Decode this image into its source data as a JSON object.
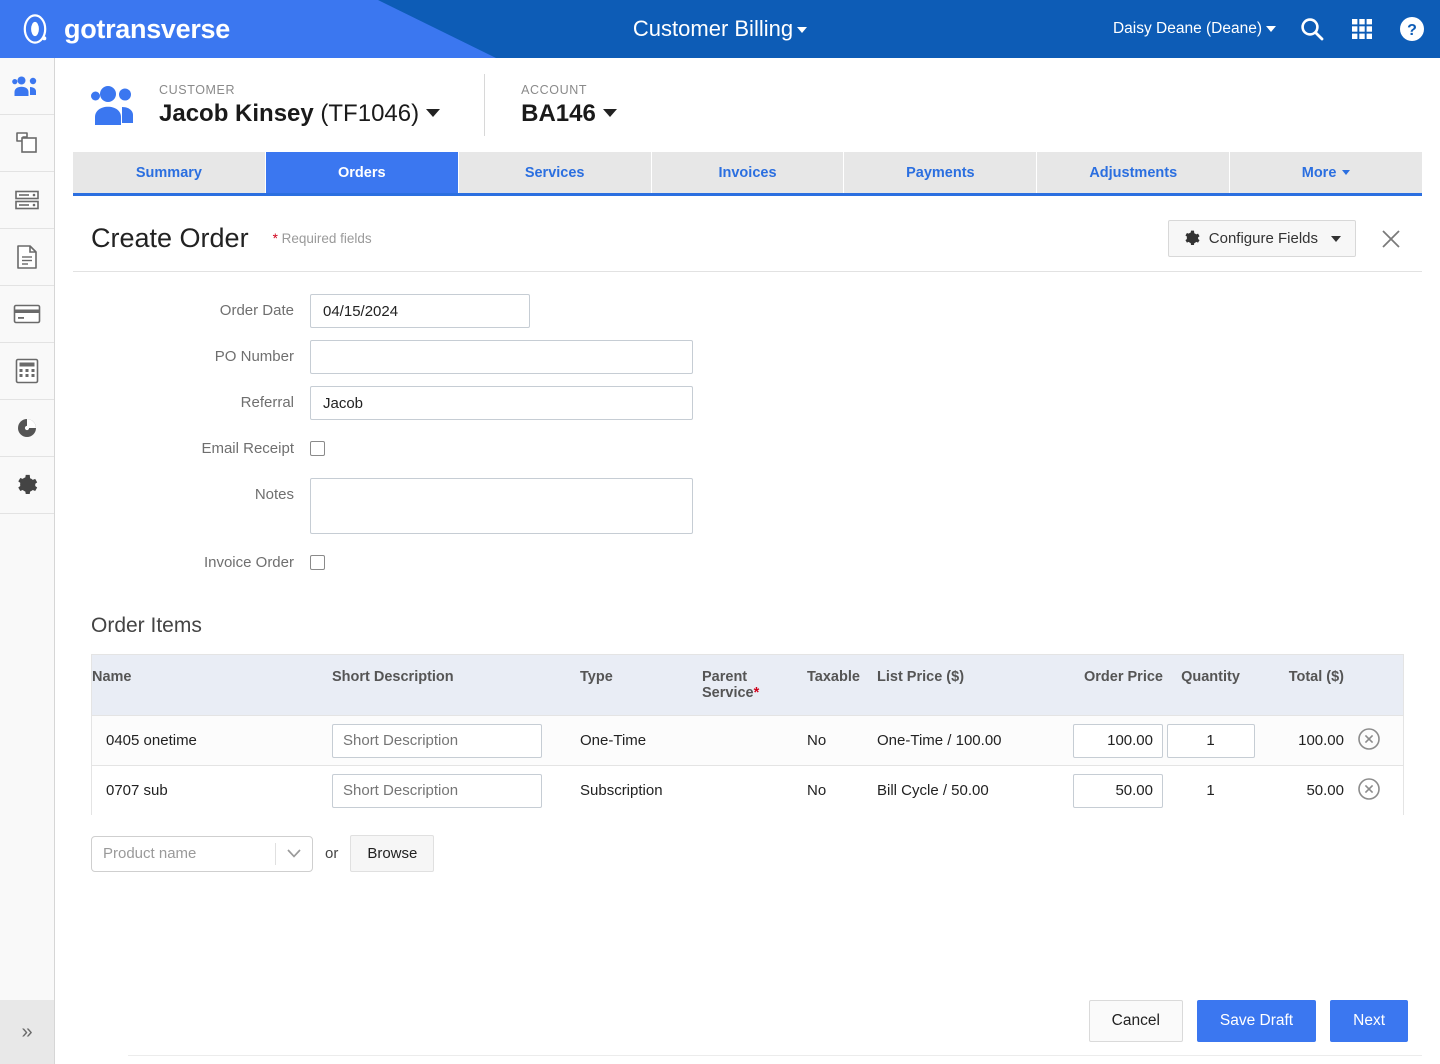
{
  "header": {
    "brand": "gotransverse",
    "brand_logo_icon": "gotransverse-logo-icon",
    "app_title": "Customer Billing",
    "user": "Daisy Deane (Deane)",
    "icons": [
      "search-icon",
      "apps-grid-icon",
      "help-icon"
    ],
    "accent_blue": "#0d5cb6",
    "accent_blue_light": "#3b77f0"
  },
  "sidebar": {
    "items": [
      {
        "icon": "customers-icon",
        "active": true
      },
      {
        "icon": "products-copy-icon",
        "active": false
      },
      {
        "icon": "server-database-icon",
        "active": false
      },
      {
        "icon": "document-icon",
        "active": false
      },
      {
        "icon": "credit-card-icon",
        "active": false
      },
      {
        "icon": "calculator-icon",
        "active": false
      },
      {
        "icon": "dashboard-gauge-icon",
        "active": false
      },
      {
        "icon": "gear-settings-icon",
        "active": false
      }
    ],
    "expand_label": "»"
  },
  "context_bar": {
    "customer_icon": "customers-icon",
    "customer_label": "CUSTOMER",
    "customer_name": "Jacob Kinsey",
    "customer_id": "(TF1046)",
    "account_label": "ACCOUNT",
    "account_value": "BA146"
  },
  "tabs": [
    {
      "label": "Summary",
      "active": false,
      "caret": false
    },
    {
      "label": "Orders",
      "active": true,
      "caret": false
    },
    {
      "label": "Services",
      "active": false,
      "caret": false
    },
    {
      "label": "Invoices",
      "active": false,
      "caret": false
    },
    {
      "label": "Payments",
      "active": false,
      "caret": false
    },
    {
      "label": "Adjustments",
      "active": false,
      "caret": false
    },
    {
      "label": "More",
      "active": false,
      "caret": true
    }
  ],
  "page": {
    "title": "Create Order",
    "required_star": "*",
    "required_note": "Required fields",
    "configure_fields_label": "Configure Fields",
    "close_label": "×"
  },
  "form": {
    "order_date": {
      "label": "Order Date",
      "value": "04/15/2024",
      "placeholder": ""
    },
    "po_number": {
      "label": "PO Number",
      "value": "",
      "placeholder": ""
    },
    "referral": {
      "label": "Referral",
      "value": "Jacob",
      "placeholder": ""
    },
    "email_receipt": {
      "label": "Email Receipt",
      "checked": false
    },
    "notes": {
      "label": "Notes",
      "value": "",
      "placeholder": ""
    },
    "invoice_order": {
      "label": "Invoice Order",
      "checked": false
    }
  },
  "order_items": {
    "section_title": "Order Items",
    "columns": [
      "Name",
      "Short Description",
      "Type",
      "Parent Service",
      "Taxable",
      "List Price ($)",
      "Order Price",
      "Quantity",
      "Total ($)"
    ],
    "parent_service_required_star": "*",
    "rows": [
      {
        "name": "0405 onetime",
        "short_description": "",
        "short_description_placeholder": "Short Description",
        "type": "One-Time",
        "parent_service": "",
        "taxable": "No",
        "list_price": "One-Time / 100.00",
        "order_price": "100.00",
        "quantity": "1",
        "quantity_editable": true,
        "total": "100.00",
        "delete_icon": "remove-circle-icon"
      },
      {
        "name": "0707 sub",
        "short_description": "",
        "short_description_placeholder": "Short Description",
        "type": "Subscription",
        "parent_service": "",
        "taxable": "No",
        "list_price": "Bill Cycle / 50.00",
        "order_price": "50.00",
        "quantity": "1",
        "quantity_editable": false,
        "total": "50.00",
        "delete_icon": "remove-circle-icon"
      }
    ],
    "add_product_placeholder": "Product name",
    "or_label": "or",
    "browse_label": "Browse"
  },
  "footer": {
    "cancel_label": "Cancel",
    "save_draft_label": "Save Draft",
    "next_label": "Next"
  }
}
